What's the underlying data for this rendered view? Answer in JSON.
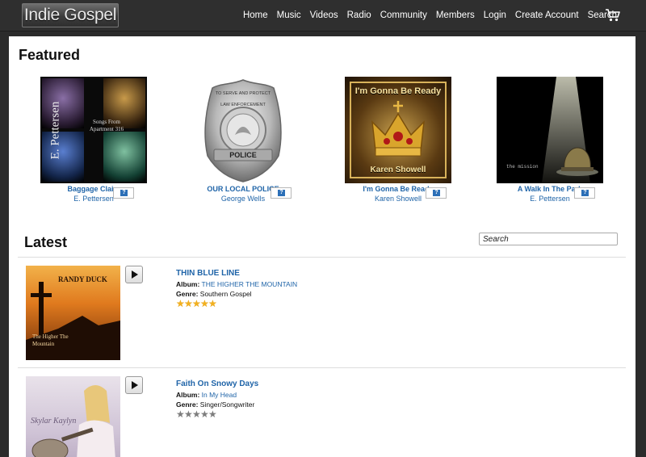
{
  "header": {
    "logo": "Indie Gospel",
    "nav": [
      "Home",
      "Music",
      "Videos",
      "Radio",
      "Community",
      "Members",
      "Login",
      "Create Account",
      "Search"
    ],
    "cart_icon": "cart-icon"
  },
  "featured": {
    "title": "Featured",
    "items": [
      {
        "title": "Baggage Claim",
        "artist": "E. Pettersen",
        "cover_text": "E. Pettersen",
        "cover_subtext": "Songs From Apartment 316"
      },
      {
        "title": "OUR LOCAL POLICE",
        "artist": "George Wells",
        "cover_text": "POLICE",
        "cover_subtext": "LAW ENFORCEMENT",
        "cover_top": "TO SERVE AND PROTECT"
      },
      {
        "title": "I'm Gonna Be Ready",
        "artist": "Karen Showell",
        "cover_text": "I'm Gonna Be Ready",
        "cover_subtext": "Karen Showell"
      },
      {
        "title": "A Walk In The Park",
        "artist": "E. Pettersen",
        "cover_text": "the mission"
      }
    ]
  },
  "latest": {
    "title": "Latest",
    "search": {
      "placeholder": "Search"
    },
    "rows": [
      {
        "song": "THIN BLUE LINE",
        "album_label": "Album:",
        "album": "THE HIGHER THE MOUNTAIN",
        "genre_label": "Genre:",
        "genre": "Southern Gospel",
        "rating": 5,
        "cover_text": "RANDY DUCK",
        "cover_subtext": "The Higher The Mountain"
      },
      {
        "song": "Faith On Snowy Days",
        "album_label": "Album:",
        "album": "In My Head",
        "genre_label": "Genre:",
        "genre": "Singer/Songwriter",
        "rating": 0,
        "cover_text": "Skylar Kaylyn"
      }
    ]
  },
  "colors": {
    "link": "#1f64a8",
    "topbar": "#2f2f2f",
    "star_gold": "#f2b01e",
    "star_grey": "#7d7d7d"
  }
}
